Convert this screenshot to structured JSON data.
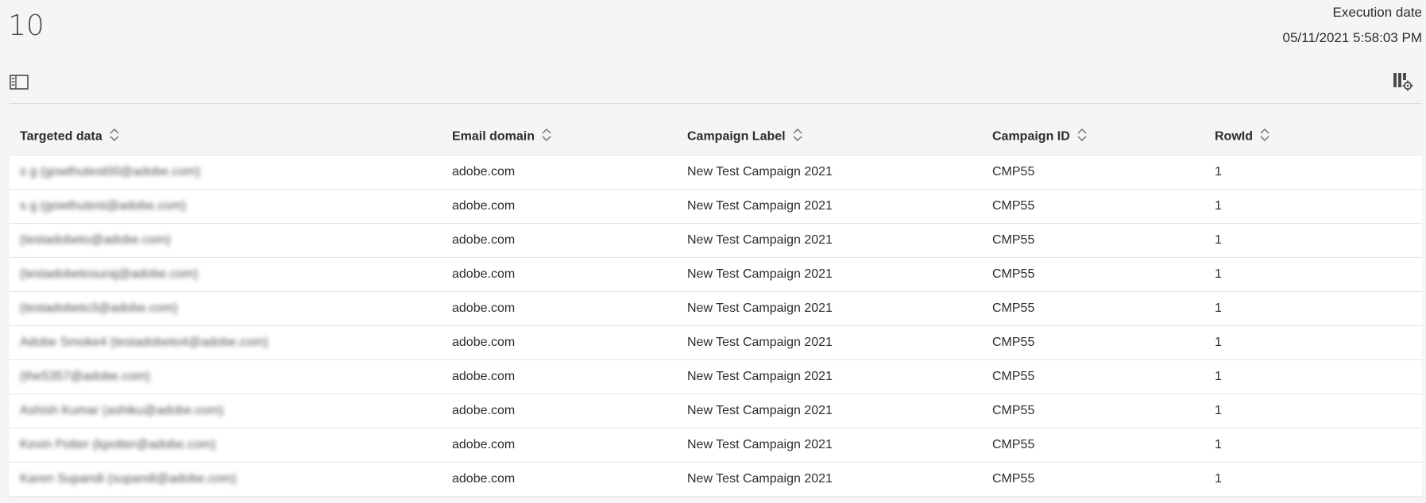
{
  "summary": {
    "count": "10",
    "execution_label": "Execution date",
    "execution_date": "05/11/2021 5:58:03 PM"
  },
  "toolbar": {
    "left_icon": "panel-toggle-icon",
    "right_icon": "column-settings-icon"
  },
  "table": {
    "columns": [
      "Targeted data",
      "Email domain",
      "Campaign Label",
      "Campaign ID",
      "RowId"
    ],
    "rows": [
      [
        "s g (gowthutest00@adobe.com)",
        "adobe.com",
        "New Test Campaign 2021",
        "CMP55",
        "1"
      ],
      [
        "s g (gowthutest@adobe.com)",
        "adobe.com",
        "New Test Campaign 2021",
        "CMP55",
        "1"
      ],
      [
        "(testadobeto@adobe.com)",
        "adobe.com",
        "New Test Campaign 2021",
        "CMP55",
        "1"
      ],
      [
        "(testadobetosuraj@adobe.com)",
        "adobe.com",
        "New Test Campaign 2021",
        "CMP55",
        "1"
      ],
      [
        "(testadobeto3@adobe.com)",
        "adobe.com",
        "New Test Campaign 2021",
        "CMP55",
        "1"
      ],
      [
        "Adobe Smoke4 (testadobeto4@adobe.com)",
        "adobe.com",
        "New Test Campaign 2021",
        "CMP55",
        "1"
      ],
      [
        "(the5357@adobe.com)",
        "adobe.com",
        "New Test Campaign 2021",
        "CMP55",
        "1"
      ],
      [
        "Ashish Kumar (ashiku@adobe.com)",
        "adobe.com",
        "New Test Campaign 2021",
        "CMP55",
        "1"
      ],
      [
        "Kevin Potter (kpotter@adobe.com)",
        "adobe.com",
        "New Test Campaign 2021",
        "CMP55",
        "1"
      ],
      [
        "Karen Supandi (supandi@adobe.com)",
        "adobe.com",
        "New Test Campaign 2021",
        "CMP55",
        "1"
      ]
    ],
    "sort_icon": "sort-chevrons-icon"
  }
}
